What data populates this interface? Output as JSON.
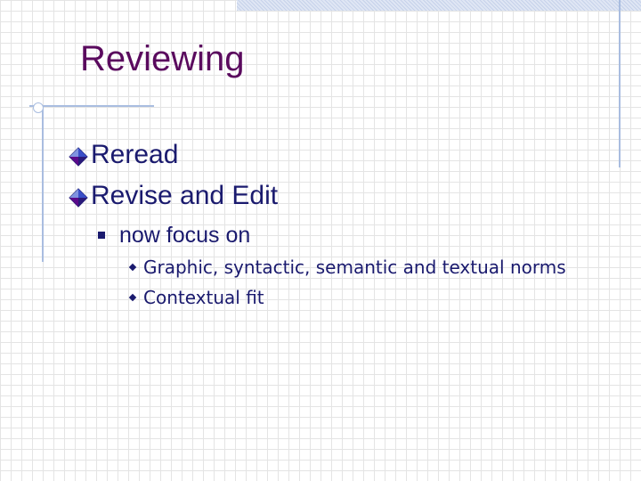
{
  "title": "Reviewing",
  "bullets": [
    {
      "text": "Reread",
      "icon": "diamond-bullet-icon"
    },
    {
      "text": "Revise and Edit",
      "icon": "diamond-bullet-icon",
      "children": [
        {
          "text": "now focus on",
          "icon": "square-bullet-icon",
          "children": [
            {
              "text": "Graphic, syntactic, semantic and textual norms",
              "icon": "small-diamond-bullet-icon"
            },
            {
              "text": "Contextual fit",
              "icon": "small-diamond-bullet-icon"
            }
          ]
        }
      ]
    }
  ],
  "colors": {
    "title": "#5a0a5e",
    "text": "#1a1a6e",
    "accent_lines": "#a9bde0",
    "grid": "#e4e4e4",
    "diamond_blue": "#3a4fc8",
    "diamond_purple": "#5a0a8a"
  }
}
